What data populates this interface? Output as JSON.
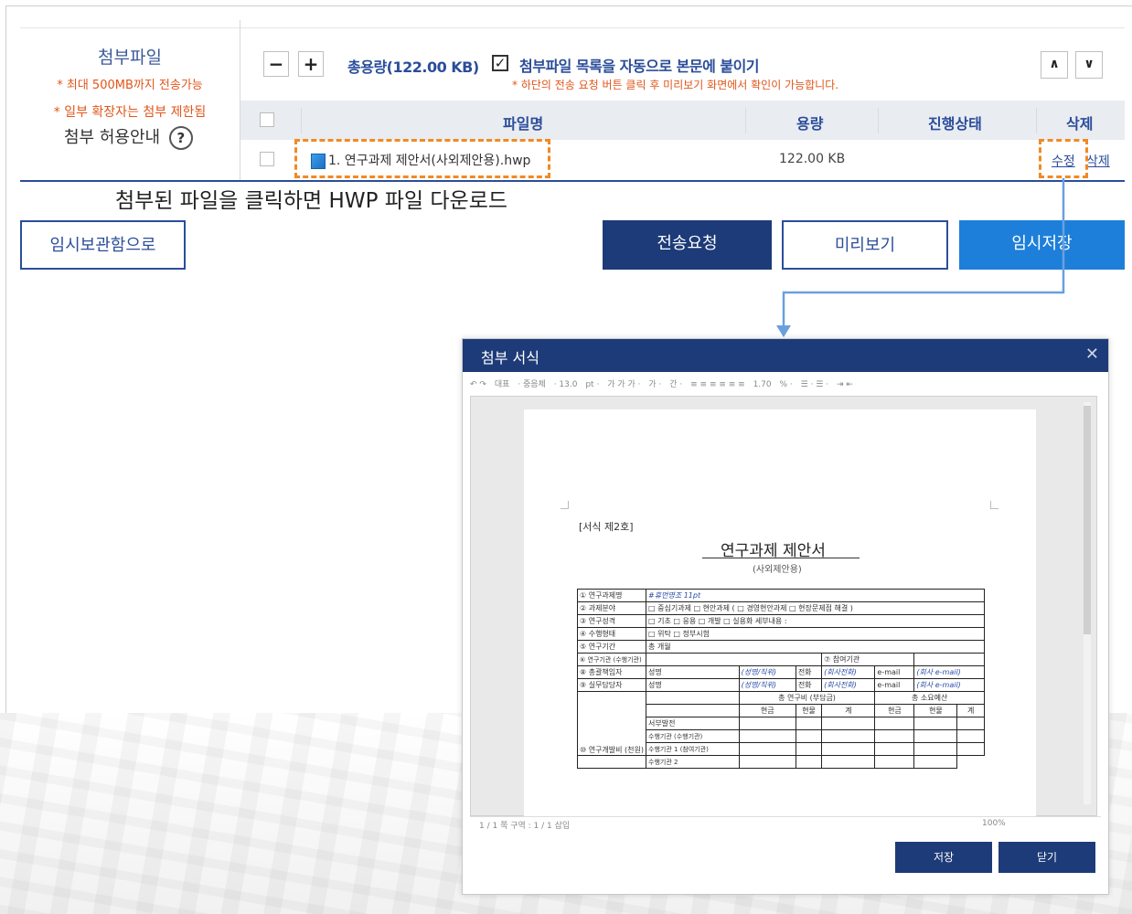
{
  "attach": {
    "title": "첨부파일",
    "note_max": "* 최대 500MB까지 전송가능",
    "note_ext": "* 일부 확장자는 첨부 제한됨",
    "guide": "첨부 허용안내",
    "help_glyph": "?"
  },
  "toolbar": {
    "minus": "−",
    "plus": "+",
    "total": "총용량(122.00 KB)",
    "checkbox_glyph": "✓",
    "auto_attach": "첨부파일 목록을 자동으로 본문에 붙이기",
    "auto_note": "* 하단의 전송 요청 버튼 클릭 후 미리보기 화면에서 확인이 가능합니다.",
    "up": "∧",
    "down": "∨"
  },
  "table": {
    "headers": [
      "파일명",
      "용량",
      "진행상태",
      "삭제"
    ],
    "row": {
      "name": "1. 연구과제 제안서(사외제안용).hwp",
      "size": "122.00 KB",
      "edit": "수정",
      "delete": "삭제"
    }
  },
  "caption": "첨부된 파일을 클릭하면 HWP 파일 다운로드",
  "buttons": {
    "temp_box": "임시보관함으로",
    "send": "전송요청",
    "preview": "미리보기",
    "temp_save": "임시저장"
  },
  "modal": {
    "title": "첨부 서식",
    "close": "✕",
    "toolbar_items": [
      "↶ ↷",
      "대표",
      "· 중음체",
      "· 13.0",
      "pt ·",
      "가 가 가 ·",
      "가 ·",
      "간 ·",
      "≡ ≡ ≡ ≡ ≡ ≡",
      "1.70",
      "% ·",
      "☰ · ☰ ·",
      "⇥ ⇤"
    ],
    "status_left": "1 / 1 쪽   구역 : 1 / 1   삽입",
    "status_right": "100%",
    "doc": {
      "form_no": "[서식 제2호]",
      "title": "연구과제 제안서",
      "subtitle": "(사외제안용)",
      "rows": [
        [
          "① 연구과제명",
          "#휴먼명조 11pt"
        ],
        [
          "② 과제분야",
          "□ 중심기과제  □ 현안과제 ( □ 경영현안과제 □ 현장문제점 해결 )"
        ],
        [
          "③ 연구성격",
          "□ 기초  □ 응용  □ 개발  □ 실용화 세부내용 :"
        ],
        [
          "④ 수행형태",
          "□ 위탁  □ 정부시험"
        ],
        [
          "⑤ 연구기간",
          "총     개월"
        ],
        [
          "⑥ 연구기관 (수행기관)",
          "⑦ 참여기관"
        ],
        [
          "⑧ 총괄책임자",
          "성명",
          "(성명/직위)",
          "전화",
          "(회사전화)",
          "e-mail",
          "(회사 e-mail)"
        ],
        [
          "⑨ 실무담당자",
          "성명",
          "(성명/직위)",
          "전화",
          "(회사전화)",
          "e-mail",
          "(회사 e-mail)"
        ],
        [
          "총 연구비 (부담금)",
          "총 소요예산"
        ],
        [
          "현금",
          "현물",
          "계",
          "현금",
          "현물",
          "계"
        ],
        [
          "⑩ 연구개발비 (천원)",
          "서부발전",
          "수행기관 (수행기관)",
          "수행기관 1 (참여기관)",
          "수행기관 2"
        ]
      ]
    },
    "save": "저장",
    "close_button": "닫기"
  }
}
